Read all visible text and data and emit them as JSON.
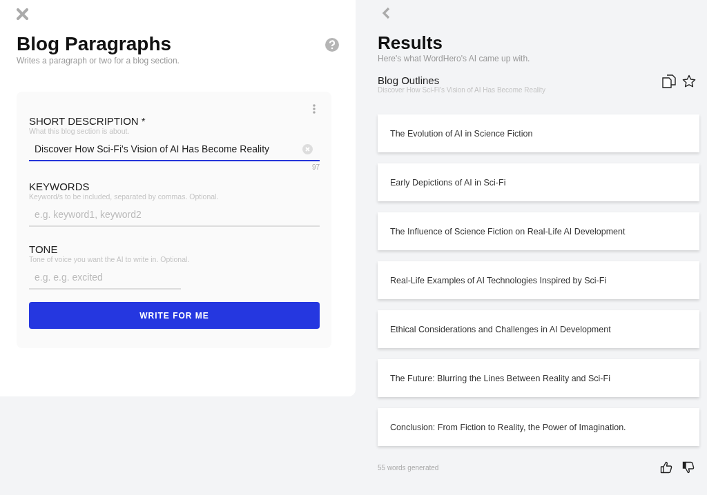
{
  "form": {
    "title": "Blog Paragraphs",
    "subtitle": "Writes a paragraph or two for a blog section.",
    "fields": [
      {
        "label": "SHORT DESCRIPTION *",
        "hint": "What this blog section is about.",
        "value": "Discover How Sci-Fi's Vision of AI Has Become Reality",
        "counter": "97",
        "focused": true,
        "kind": "wide"
      },
      {
        "label": "KEYWORDS",
        "hint": "Keyword/s to be included, separated by commas. Optional.",
        "placeholder": "e.g. keyword1, keyword2",
        "focused": false,
        "kind": "wide"
      },
      {
        "label": "TONE",
        "hint": "Tone of voice you want the AI to write in. Optional.",
        "placeholder": "e.g. e.g. excited",
        "focused": false,
        "kind": "narrow"
      }
    ],
    "submit": "WRITE FOR ME"
  },
  "results": {
    "title": "Results",
    "subtitle": "Here's what WordHero's AI came up with.",
    "section_title": "Blog Outlines",
    "section_subtitle": "Discover How Sci-Fi's Vision of AI Has Become Reality",
    "items": [
      "The Evolution of AI in Science Fiction",
      "Early Depictions of AI in Sci-Fi",
      "The Influence of Science Fiction on Real-Life AI Development",
      "Real-Life Examples of AI Technologies Inspired by Sci-Fi",
      "Ethical Considerations and Challenges in AI Development",
      "The Future: Blurring the Lines Between Reality and Sci-Fi",
      "Conclusion: From Fiction to Reality, the Power of Imagination."
    ],
    "footer": "55 words generated"
  }
}
